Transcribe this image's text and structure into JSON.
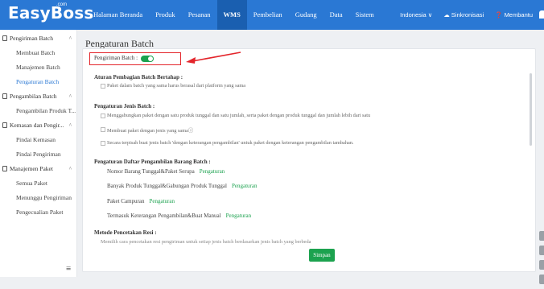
{
  "brand": {
    "logo": "EasyBoss",
    "suffix": ".com"
  },
  "topnav": {
    "items": [
      "Halaman Beranda",
      "Produk",
      "Pesanan",
      "WMS",
      "Pembelian",
      "Gudang",
      "Data",
      "Sistem"
    ],
    "active": "WMS",
    "region": "Indonesia ∨",
    "sync": "Sinkronisasi",
    "help": "Membantu"
  },
  "sidebar": {
    "groups": [
      {
        "label": "Pengiriman Batch",
        "chevron": "^",
        "items": [
          "Membuat Batch",
          "Manajemen Batch",
          "Pengaturan Batch"
        ]
      },
      {
        "label": "Pengambilan Batch",
        "chevron": "^",
        "items": [
          "Pengambilan Produk T..."
        ]
      },
      {
        "label": "Kemasan dan Pengir...",
        "chevron": "^",
        "items": [
          "Pindai Kemasan",
          "Pindai Pengiriman"
        ]
      },
      {
        "label": "Manajemen Paket",
        "chevron": "^",
        "items": [
          "Semua Paket",
          "Menunggu Pengiriman",
          "Pengecualian Paket"
        ]
      }
    ],
    "active_item": "Pengaturan Batch",
    "menu_icon": "≡"
  },
  "page": {
    "title": "Pengaturan Batch",
    "toggle_label": "Pengiriman Batch :",
    "toggle_on": true,
    "rules_title": "Aturan Pembagian Batch Bertahap :",
    "rules_options": [
      "Paket dalam batch yang sama harus berasal dari platform yang sama"
    ],
    "type_title": "Pengaturan Jenis Batch :",
    "type_options": [
      "Menggabungkan paket dengan satu produk tunggal dan satu jumlah, serta paket dengan produk tunggal dan jumlah lebih dari satu",
      "Membuat paket dengan jenis yang samaⓘ",
      "Secara terpisah buat jenis batch 'dengan keterangan pengambilan' untuk paket dengan keterangan pengambilan tambahan."
    ],
    "list_title": "Pengaturan Daftar Pengambilan Barang Batch :",
    "list_rows": [
      {
        "label": "Nomor Barang Tunggal&Paket Serupa",
        "link": "Pengaturan"
      },
      {
        "label": "Banyak Produk Tunggal&Gabungan Produk Tunggal",
        "link": "Pengaturan"
      },
      {
        "label": "Paket Campuran",
        "link": "Pengaturan"
      },
      {
        "label": "Termasuk Keterangan Pengambilan&Buat Manual",
        "link": "Pengaturan"
      }
    ],
    "print_title": "Metode Pencetakan Resi :",
    "print_hint": "Memilih cara pencetakan resi pengiriman untuk setiap jenis batch berdasarkan jenis batch yang berbeda",
    "save": "Simpan"
  },
  "colors": {
    "primary": "#2a78d4",
    "accent": "#1ca24f",
    "highlight": "#e3252b"
  }
}
